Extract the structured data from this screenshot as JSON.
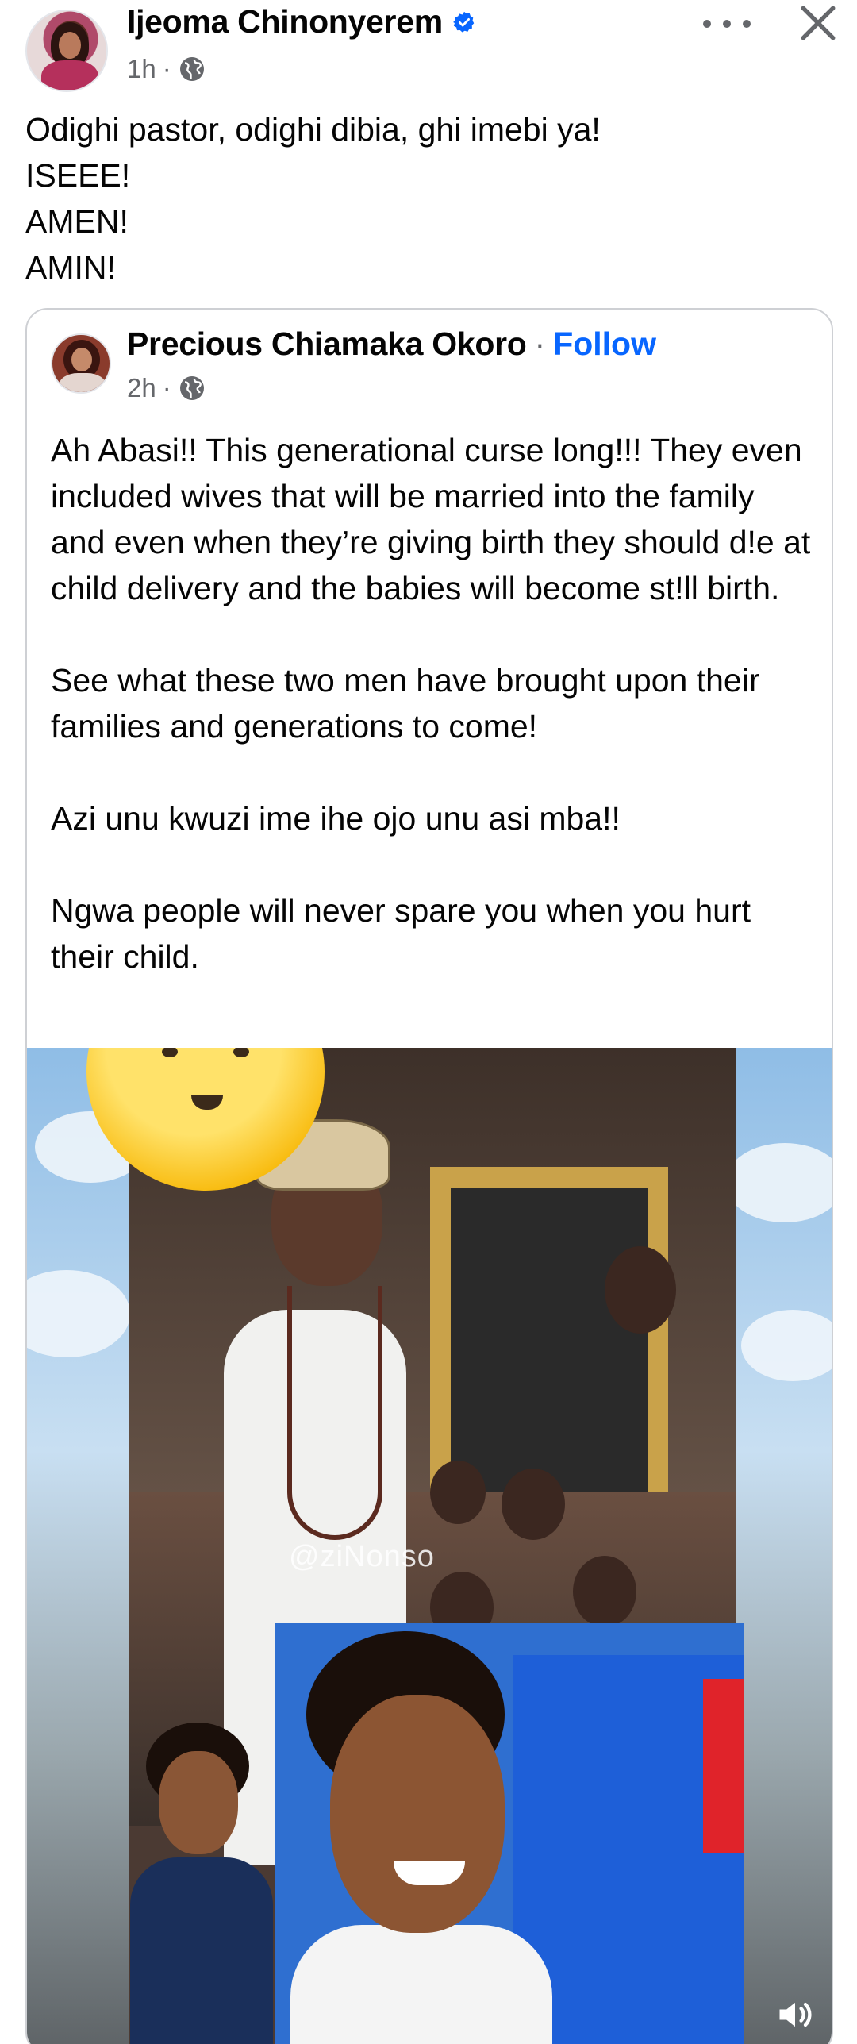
{
  "post": {
    "author": "Ijeoma Chinonyerem",
    "time": "1h",
    "time_sep": "·",
    "lines": [
      "Odighi pastor, odighi dibia, ghi imebi ya!",
      "ISEEE!",
      "AMEN!",
      "AMIN!"
    ]
  },
  "shared": {
    "author": "Precious Chiamaka Okoro",
    "sep": "·",
    "follow_label": "Follow",
    "time": "2h",
    "time_sep": "·",
    "paragraphs": [
      "Ah Abasi!! This generational curse long!!! They even included wives that will be married into the family and even when they’re giving birth they should d!e at child delivery and the babies will become st!ll birth.",
      "See what these two men have brought upon their families and generations to come!",
      "Azi unu kwuzi ime ihe ojo unu asi mba!!",
      "Ngwa people will never spare you when you hurt their child."
    ],
    "video_watermark": "@ziNonso"
  },
  "colors": {
    "accent": "#0866ff",
    "verified": "#0866ff",
    "secondary_text": "#65676b"
  },
  "icons": [
    "verified-badge-icon",
    "globe-icon",
    "more-options-icon",
    "close-icon",
    "sound-on-icon"
  ]
}
